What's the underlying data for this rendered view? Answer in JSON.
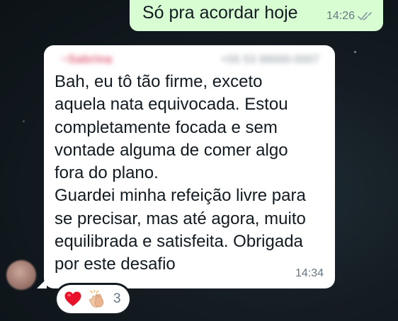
{
  "outgoing_message": {
    "text": "Só pra acordar hoje",
    "time": "14:26",
    "status_icon": "double-check-icon"
  },
  "incoming_message": {
    "sender_name": "~Sabrina",
    "sender_phone": "+55 53 99000-0007",
    "lines": [
      "Bah, eu tô tão firme, exceto",
      "aquela nata equivocada. Estou",
      "completamente focada e sem",
      "vontade alguma de comer algo",
      "fora do plano.",
      "Guardei minha refeição livre para",
      "se precisar, mas até agora, muito",
      "equilibrada e satisfeita. Obrigada",
      "por este desafio"
    ],
    "time": "14:34"
  },
  "reactions": {
    "emojis": [
      "red-heart-icon",
      "clapping-hands-icon"
    ],
    "count": "3"
  },
  "colors": {
    "outgoing_bubble": "#d9fdd3",
    "incoming_bubble": "#ffffff",
    "sender_name": "#e26d82",
    "meta_text": "#667781",
    "background": "#141c22"
  }
}
